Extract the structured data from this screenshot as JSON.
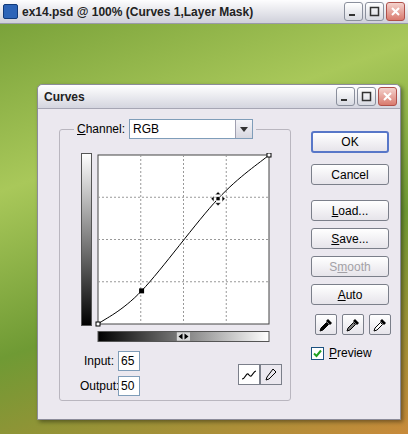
{
  "document": {
    "title": "ex14.psd @ 100% (Curves 1,Layer Mask)"
  },
  "dialog": {
    "title": "Curves",
    "channel": {
      "label": "Channel:",
      "mnemonic": 0,
      "value": "RGB"
    },
    "buttons": [
      {
        "label": "OK",
        "disabled": false,
        "default": true,
        "mnemonic": -1
      },
      {
        "label": "Cancel",
        "disabled": false,
        "default": false,
        "mnemonic": -1
      },
      {
        "label": "Load...",
        "disabled": false,
        "default": false,
        "mnemonic": 0
      },
      {
        "label": "Save...",
        "disabled": false,
        "default": false,
        "mnemonic": 0
      },
      {
        "label": "Smooth",
        "disabled": true,
        "default": false,
        "mnemonic": 1
      },
      {
        "label": "Auto",
        "disabled": false,
        "default": false,
        "mnemonic": 0
      }
    ],
    "curve": {
      "points": [
        {
          "input": 0,
          "output": 0,
          "selected": false
        },
        {
          "input": 65,
          "output": 50,
          "selected": false
        },
        {
          "input": 179,
          "output": 189,
          "selected": true
        },
        {
          "input": 255,
          "output": 255,
          "selected": false
        }
      ]
    },
    "input": {
      "label": "Input:",
      "value": "65"
    },
    "output": {
      "label": "Output:",
      "value": "50"
    },
    "tools": [
      {
        "kind": "curve",
        "selected": true
      },
      {
        "kind": "pencil",
        "selected": false
      }
    ],
    "preview": {
      "label": "Preview",
      "mnemonic": 0,
      "checked": true
    }
  }
}
